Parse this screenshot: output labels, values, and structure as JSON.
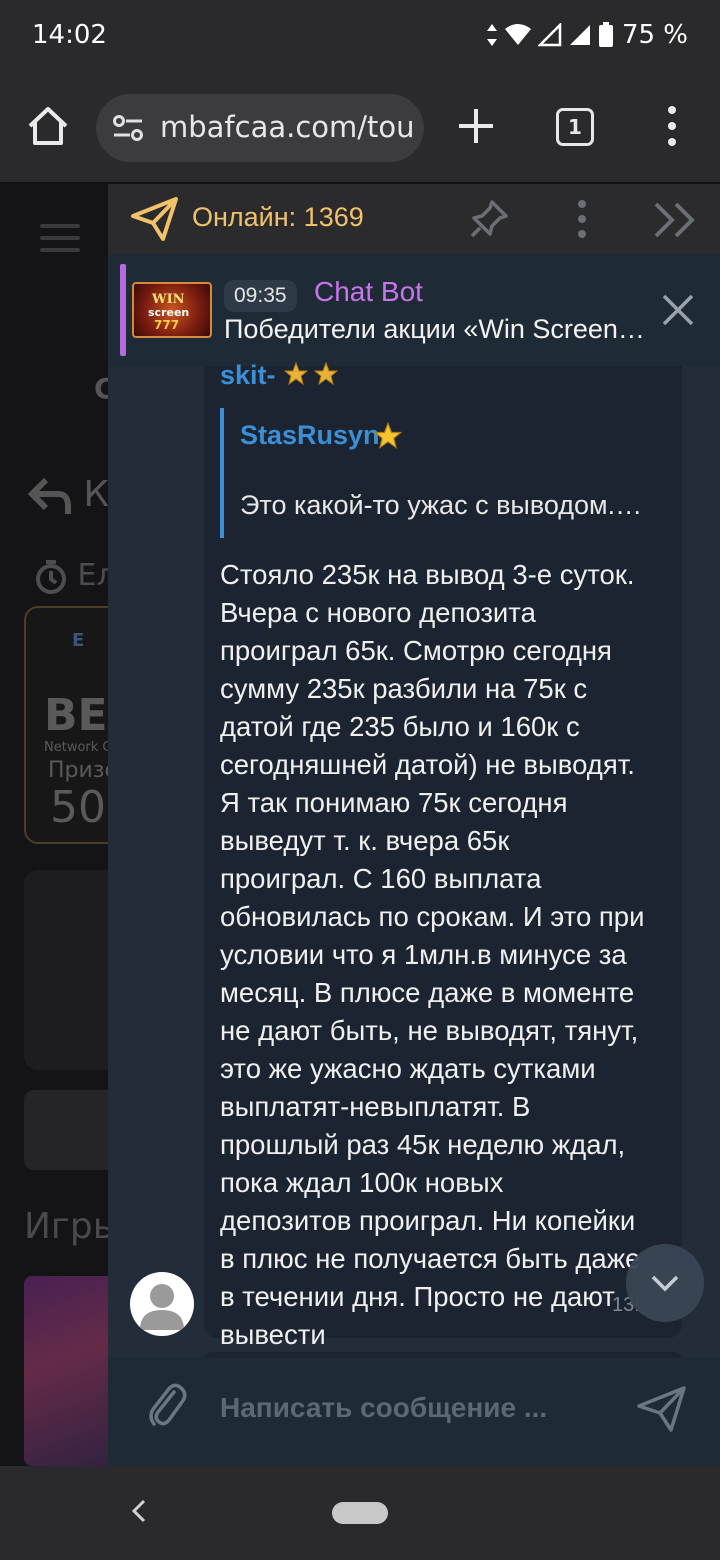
{
  "status_bar": {
    "time": "14:02",
    "battery": "75 %",
    "icons": [
      "data-arrows-icon",
      "wifi-icon",
      "signal-icon",
      "signal-icon",
      "battery-icon"
    ]
  },
  "browser": {
    "url": "mbafcaa.com/tou",
    "tab_count": "1"
  },
  "background_page": {
    "c_letter": "C",
    "back_label": "К",
    "clock_label": "Ел",
    "card_brand": "E",
    "card_title": "BE",
    "card_sub": "Network C",
    "card_prize": "Призо",
    "card_value": "50",
    "games_heading": "Игры"
  },
  "chat": {
    "online_label": "Онлайн: 1369",
    "pinned": {
      "time": "09:35",
      "author": "Chat Bot",
      "text": "Победители акции «Win Screen…",
      "image_text": [
        "WIN",
        "screen",
        "777"
      ]
    },
    "message": {
      "username": "skit-",
      "quote_user": "StasRusyn",
      "quote_text": "Это какой-то ужас с выводом.…",
      "body": "Стояло 235к на вывод 3-е суток.\nВчера с нового депозита\nпроиграл 65к. Смотрю сегодня\nсумму 235к разбили на 75к с\nдатой где 235 было и 160к с\nсегодняшней датой) не выводят.\nЯ так понимаю 75к сегодня\nвыведут т. к. вчера 65к\nпроиграл. С 160 выплата\nобновилась по срокам. И это при\nусловии что я 1млн.в минусе за\nмесяц. В плюсе даже в моменте\nне дают быть, не выводят, тянут,\nэто же ужасно ждать сутками\nвыплатят-невыплатят. В\nпрошлый раз 45к неделю ждал,\nпока ждал 100к новых\nдепозитов проиграл. Ни копейки\nв плюс не получается быть даже\nв течении дня. Просто не дают\nвывести",
      "time": "13:"
    },
    "input_placeholder": "Написать сообщение ..."
  },
  "colors": {
    "online_accent": "#f2c26b",
    "bot_name": "#c874ea",
    "username_blue": "#3b8fd6",
    "chat_bg": "#232d3a",
    "message_bg": "#1b2430"
  }
}
